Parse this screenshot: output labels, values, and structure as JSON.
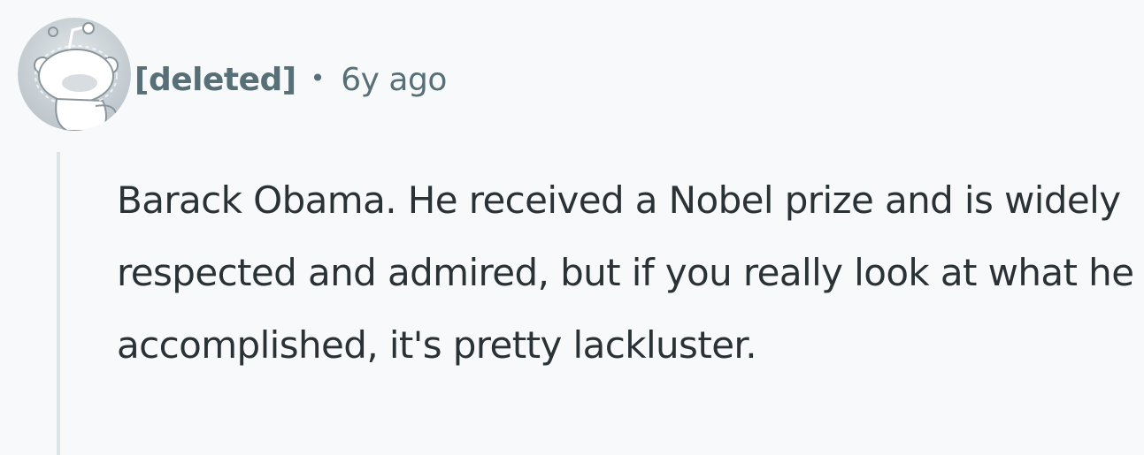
{
  "comment": {
    "author": "[deleted]",
    "separator": "•",
    "age": "6y ago",
    "avatar_icon": "snoo-deleted-avatar-icon",
    "body": "Barack Obama. He received a Nobel prize and is widely respected and admired, but if you really look at what he accomplished, it's pretty lackluster."
  },
  "colors": {
    "background": "#f7f9fa",
    "meta_text": "#576f76",
    "body_text": "#2a3236",
    "thread_line": "#dde4e8"
  }
}
